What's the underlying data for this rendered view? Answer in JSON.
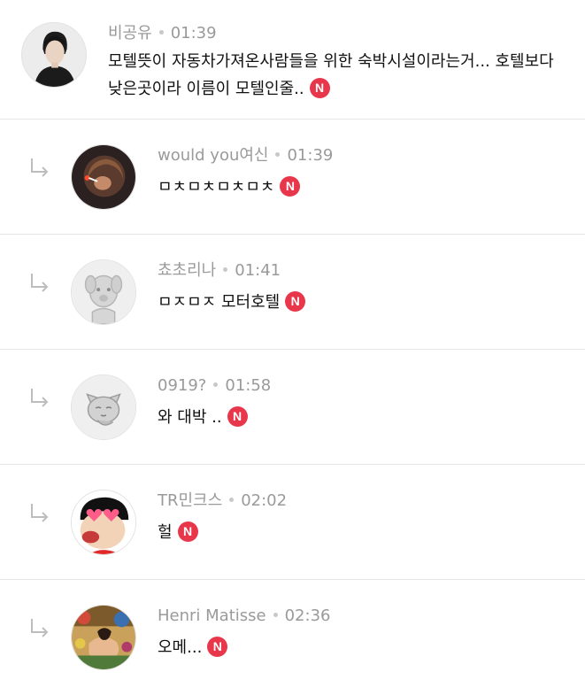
{
  "colors": {
    "new_badge": "#e8374b",
    "meta_text": "#9a9a9a",
    "divider": "#e6e6e6"
  },
  "comments": [
    {
      "nickname": "비공유",
      "time": "01:39",
      "text_line1": "모텔뜻이 자동차가져온사람들을 위한 숙박시설이라는거... 호텔보다",
      "text_line2": "낮은곳이라 이름이 모텔인줄..",
      "badge": "N",
      "avatar_icon": "man-portrait-avatar"
    },
    {
      "nickname": "would you여신",
      "time": "01:39",
      "text": "ㅁㅊㅁㅊㅁㅊㅁㅊ",
      "badge": "N",
      "avatar_icon": "smoking-character-avatar",
      "reply_icon": "reply-arrow-icon"
    },
    {
      "nickname": "쵸초리나",
      "time": "01:41",
      "text": "ㅁㅈㅁㅈ 모터호텔",
      "badge": "N",
      "avatar_icon": "default-dog-avatar",
      "reply_icon": "reply-arrow-icon"
    },
    {
      "nickname": "0919?",
      "time": "01:58",
      "text": "와 대박 ..",
      "badge": "N",
      "avatar_icon": "default-cat-avatar",
      "reply_icon": "reply-arrow-icon"
    },
    {
      "nickname": "TR민크스",
      "time": "02:02",
      "text": "헐",
      "badge": "N",
      "avatar_icon": "cartoon-boy-heart-eyes-avatar",
      "reply_icon": "reply-arrow-icon"
    },
    {
      "nickname": "Henri Matisse",
      "time": "02:36",
      "text": "오메...",
      "badge": "N",
      "avatar_icon": "painting-avatar",
      "reply_icon": "reply-arrow-icon"
    }
  ]
}
